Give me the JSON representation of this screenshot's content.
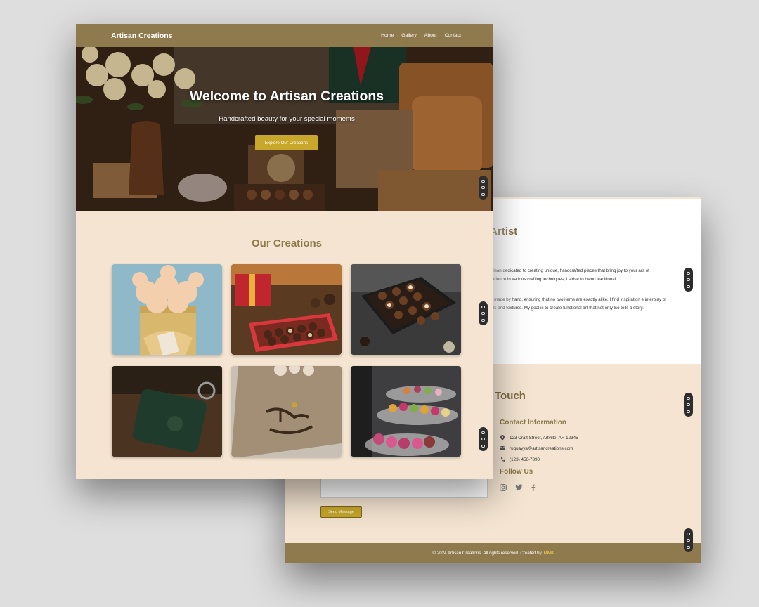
{
  "back": {
    "about_title": "ne Artist",
    "about_p1": "n artisan dedicated to creating unique, handcrafted pieces that bring joy to your ars of experience in various crafting techniques, I strive to blend traditional",
    "about_p2": "ngly made by hand, ensuring that no two items are exactly alike. I find inspiration e interplay of colors and textures. My goal is to create functional art that not only lso tells a story.",
    "contact_title": "Touch",
    "contact_info_heading": "Contact Information",
    "address": "123 Craft Street, Artville, AR 12345",
    "email": "ruquayya@artisancreations.com",
    "phone": "(123) 456-7890",
    "follow_heading": "Follow Us",
    "send_button": "Send Message",
    "footer_text": "© 2024 Artisan Creations. All rights reserved. Created by",
    "footer_brand": "MMK"
  },
  "front": {
    "brand": "Artisan Creations",
    "nav": [
      "Home",
      "Gallery",
      "About",
      "Contact"
    ],
    "hero_title": "Welcome to Artisan Creations",
    "hero_subtitle": "Handcrafted beauty for your special moments",
    "hero_button": "Explore Our Creations",
    "section_title": "Our Creations"
  },
  "icons": {
    "address": "map-pin-icon",
    "email": "envelope-icon",
    "phone": "phone-icon",
    "social": [
      "instagram-icon",
      "twitter-icon",
      "facebook-icon"
    ]
  },
  "colors": {
    "nav_bg": "#8f7a4d",
    "accent": "#c8a72a",
    "page_bg": "#f4e4d1",
    "heading": "#8d7a4a"
  }
}
